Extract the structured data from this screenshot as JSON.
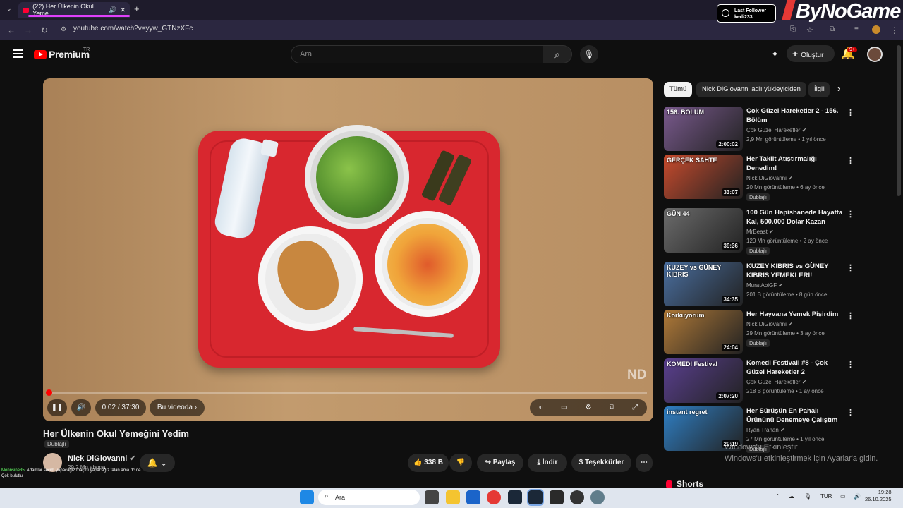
{
  "browser": {
    "tab_title": "(22) Her Ülkenin Okul Yeme",
    "url": "youtube.com/watch?v=yyw_GTNzXFc"
  },
  "overlay": {
    "last_follower_label": "Last Follower",
    "last_follower_name": "kedi233",
    "brand": "ByNoGame"
  },
  "header": {
    "logo_text": "Premium",
    "logo_region": "TR",
    "search_placeholder": "Ara",
    "create_label": "Oluştur",
    "notif_count": "9+"
  },
  "player": {
    "time": "0:02 / 37:30",
    "chapter_label": "Bu videoda",
    "watermark": "ND",
    "progress_fraction": 0.001
  },
  "video": {
    "title": "Her Ülkenin Okul Yemeğini Yedim",
    "dub_badge": "Dublajlı",
    "channel": "Nick DiGiovanni",
    "subscribers": "29,2 Mn abone",
    "likes": "338 B",
    "share": "Paylaş",
    "download": "İndir",
    "thanks": "Teşekkürler"
  },
  "chips": [
    "Tümü",
    "Nick DiGiovanni adlı yükleyiciden",
    "İlgili"
  ],
  "recommendations": [
    {
      "title": "Çok Güzel Hareketler 2 - 156. Bölüm",
      "channel": "Çok Güzel Hareketler",
      "meta": "2,9 Mn görüntüleme • 1 yıl önce",
      "duration": "2:00:02",
      "thumb_text": "156. BÖLÜM",
      "dub": "",
      "thumb_color": "#7a5a8e"
    },
    {
      "title": "Her Taklit Atıştırmalığı Denedim!",
      "channel": "Nick DiGiovanni",
      "meta": "20 Mn görüntüleme • 6 ay önce",
      "duration": "33:07",
      "thumb_text": "GERÇEK   SAHTE",
      "dub": "Dublajlı",
      "thumb_color": "#c84b2d"
    },
    {
      "title": "100 Gün Hapishanede Hayatta Kal, 500.000 Dolar Kazan",
      "channel": "MrBeast",
      "meta": "120 Mn görüntüleme • 2 ay önce",
      "duration": "39:36",
      "thumb_text": "GÜN 44",
      "dub": "Dublajlı",
      "thumb_color": "#6c6c6c"
    },
    {
      "title": "KUZEY KIBRIS vs GÜNEY KIBRIS YEMEKLERİ!",
      "channel": "MuratAbiGF",
      "meta": "201 B görüntüleme • 8 gün önce",
      "duration": "34:35",
      "thumb_text": "KUZEY vs GÜNEY KIBRIS",
      "dub": "",
      "thumb_color": "#4a6fa0"
    },
    {
      "title": "Her Hayvana Yemek Pişirdim",
      "channel": "Nick DiGiovanni",
      "meta": "29 Mn görüntüleme • 3 ay önce",
      "duration": "24:04",
      "thumb_text": "Korkuyorum",
      "dub": "Dublajlı",
      "thumb_color": "#b07a38"
    },
    {
      "title": "Komedi Festivali #8 - Çok Güzel Hareketler 2",
      "channel": "Çok Güzel Hareketler",
      "meta": "218 B görüntüleme • 1 ay önce",
      "duration": "2:07:20",
      "thumb_text": "KOMEDİ Festival",
      "dub": "",
      "thumb_color": "#5a3f8f"
    },
    {
      "title": "Her Sürüşün En Pahalı Ürününü Denemeye Çalıştım",
      "channel": "Ryan Trahan",
      "meta": "27 Mn görüntüleme • 1 yıl önce",
      "duration": "20:19",
      "thumb_text": "instant regret",
      "dub": "Dublajlı",
      "thumb_color": "#2f7fc4"
    }
  ],
  "shorts_label": "Shorts",
  "windows_activation": {
    "line1": "Windows'u Etkinleştir",
    "line2": "Windows'u etkinleştirmek için Ayarlar'a gidin."
  },
  "chat": [
    {
      "user": "Monnsine35:",
      "text": "Adamlar seçim yapacağız maçını yapacağız falan ama dc de"
    },
    {
      "user": "",
      "text": "Çok bulutlu"
    }
  ],
  "taskbar": {
    "search_placeholder": "Ara",
    "lang": "TUR",
    "time": "19:28",
    "date": "26.10.2025"
  }
}
